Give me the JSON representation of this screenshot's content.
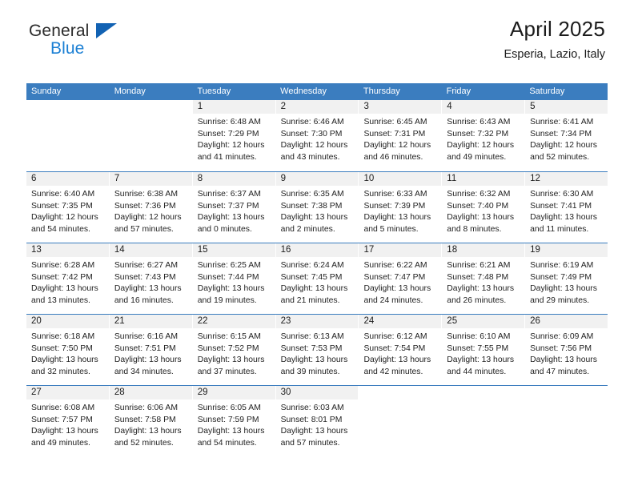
{
  "brand": {
    "word1": "General",
    "word2": "Blue",
    "triangle_color": "#1262b3",
    "word2_color": "#1a7fd4"
  },
  "header": {
    "title": "April 2025",
    "subtitle": "Esperia, Lazio, Italy"
  },
  "theme": {
    "header_blue": "#3b7dbf",
    "daynum_bar": "#f1f1f1",
    "text": "#222222"
  },
  "weekdays": [
    "Sunday",
    "Monday",
    "Tuesday",
    "Wednesday",
    "Thursday",
    "Friday",
    "Saturday"
  ],
  "weeks": [
    [
      {
        "day": "",
        "lines": []
      },
      {
        "day": "",
        "lines": []
      },
      {
        "day": "1",
        "lines": [
          "Sunrise: 6:48 AM",
          "Sunset: 7:29 PM",
          "Daylight: 12 hours",
          "and 41 minutes."
        ]
      },
      {
        "day": "2",
        "lines": [
          "Sunrise: 6:46 AM",
          "Sunset: 7:30 PM",
          "Daylight: 12 hours",
          "and 43 minutes."
        ]
      },
      {
        "day": "3",
        "lines": [
          "Sunrise: 6:45 AM",
          "Sunset: 7:31 PM",
          "Daylight: 12 hours",
          "and 46 minutes."
        ]
      },
      {
        "day": "4",
        "lines": [
          "Sunrise: 6:43 AM",
          "Sunset: 7:32 PM",
          "Daylight: 12 hours",
          "and 49 minutes."
        ]
      },
      {
        "day": "5",
        "lines": [
          "Sunrise: 6:41 AM",
          "Sunset: 7:34 PM",
          "Daylight: 12 hours",
          "and 52 minutes."
        ]
      }
    ],
    [
      {
        "day": "6",
        "lines": [
          "Sunrise: 6:40 AM",
          "Sunset: 7:35 PM",
          "Daylight: 12 hours",
          "and 54 minutes."
        ]
      },
      {
        "day": "7",
        "lines": [
          "Sunrise: 6:38 AM",
          "Sunset: 7:36 PM",
          "Daylight: 12 hours",
          "and 57 minutes."
        ]
      },
      {
        "day": "8",
        "lines": [
          "Sunrise: 6:37 AM",
          "Sunset: 7:37 PM",
          "Daylight: 13 hours",
          "and 0 minutes."
        ]
      },
      {
        "day": "9",
        "lines": [
          "Sunrise: 6:35 AM",
          "Sunset: 7:38 PM",
          "Daylight: 13 hours",
          "and 2 minutes."
        ]
      },
      {
        "day": "10",
        "lines": [
          "Sunrise: 6:33 AM",
          "Sunset: 7:39 PM",
          "Daylight: 13 hours",
          "and 5 minutes."
        ]
      },
      {
        "day": "11",
        "lines": [
          "Sunrise: 6:32 AM",
          "Sunset: 7:40 PM",
          "Daylight: 13 hours",
          "and 8 minutes."
        ]
      },
      {
        "day": "12",
        "lines": [
          "Sunrise: 6:30 AM",
          "Sunset: 7:41 PM",
          "Daylight: 13 hours",
          "and 11 minutes."
        ]
      }
    ],
    [
      {
        "day": "13",
        "lines": [
          "Sunrise: 6:28 AM",
          "Sunset: 7:42 PM",
          "Daylight: 13 hours",
          "and 13 minutes."
        ]
      },
      {
        "day": "14",
        "lines": [
          "Sunrise: 6:27 AM",
          "Sunset: 7:43 PM",
          "Daylight: 13 hours",
          "and 16 minutes."
        ]
      },
      {
        "day": "15",
        "lines": [
          "Sunrise: 6:25 AM",
          "Sunset: 7:44 PM",
          "Daylight: 13 hours",
          "and 19 minutes."
        ]
      },
      {
        "day": "16",
        "lines": [
          "Sunrise: 6:24 AM",
          "Sunset: 7:45 PM",
          "Daylight: 13 hours",
          "and 21 minutes."
        ]
      },
      {
        "day": "17",
        "lines": [
          "Sunrise: 6:22 AM",
          "Sunset: 7:47 PM",
          "Daylight: 13 hours",
          "and 24 minutes."
        ]
      },
      {
        "day": "18",
        "lines": [
          "Sunrise: 6:21 AM",
          "Sunset: 7:48 PM",
          "Daylight: 13 hours",
          "and 26 minutes."
        ]
      },
      {
        "day": "19",
        "lines": [
          "Sunrise: 6:19 AM",
          "Sunset: 7:49 PM",
          "Daylight: 13 hours",
          "and 29 minutes."
        ]
      }
    ],
    [
      {
        "day": "20",
        "lines": [
          "Sunrise: 6:18 AM",
          "Sunset: 7:50 PM",
          "Daylight: 13 hours",
          "and 32 minutes."
        ]
      },
      {
        "day": "21",
        "lines": [
          "Sunrise: 6:16 AM",
          "Sunset: 7:51 PM",
          "Daylight: 13 hours",
          "and 34 minutes."
        ]
      },
      {
        "day": "22",
        "lines": [
          "Sunrise: 6:15 AM",
          "Sunset: 7:52 PM",
          "Daylight: 13 hours",
          "and 37 minutes."
        ]
      },
      {
        "day": "23",
        "lines": [
          "Sunrise: 6:13 AM",
          "Sunset: 7:53 PM",
          "Daylight: 13 hours",
          "and 39 minutes."
        ]
      },
      {
        "day": "24",
        "lines": [
          "Sunrise: 6:12 AM",
          "Sunset: 7:54 PM",
          "Daylight: 13 hours",
          "and 42 minutes."
        ]
      },
      {
        "day": "25",
        "lines": [
          "Sunrise: 6:10 AM",
          "Sunset: 7:55 PM",
          "Daylight: 13 hours",
          "and 44 minutes."
        ]
      },
      {
        "day": "26",
        "lines": [
          "Sunrise: 6:09 AM",
          "Sunset: 7:56 PM",
          "Daylight: 13 hours",
          "and 47 minutes."
        ]
      }
    ],
    [
      {
        "day": "27",
        "lines": [
          "Sunrise: 6:08 AM",
          "Sunset: 7:57 PM",
          "Daylight: 13 hours",
          "and 49 minutes."
        ]
      },
      {
        "day": "28",
        "lines": [
          "Sunrise: 6:06 AM",
          "Sunset: 7:58 PM",
          "Daylight: 13 hours",
          "and 52 minutes."
        ]
      },
      {
        "day": "29",
        "lines": [
          "Sunrise: 6:05 AM",
          "Sunset: 7:59 PM",
          "Daylight: 13 hours",
          "and 54 minutes."
        ]
      },
      {
        "day": "30",
        "lines": [
          "Sunrise: 6:03 AM",
          "Sunset: 8:01 PM",
          "Daylight: 13 hours",
          "and 57 minutes."
        ]
      },
      {
        "day": "",
        "lines": []
      },
      {
        "day": "",
        "lines": []
      },
      {
        "day": "",
        "lines": []
      }
    ]
  ]
}
